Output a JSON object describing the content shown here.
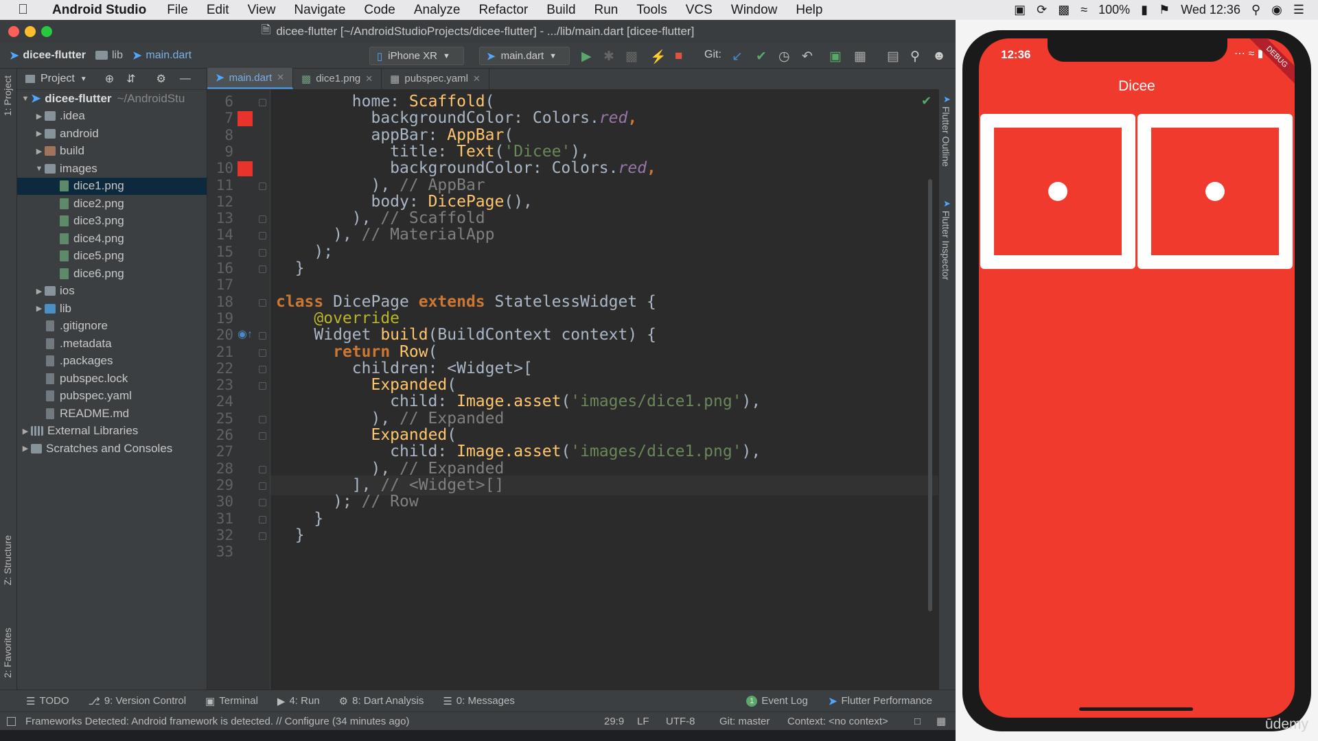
{
  "menubar": {
    "app": "Android Studio",
    "items": [
      "File",
      "Edit",
      "View",
      "Navigate",
      "Code",
      "Analyze",
      "Refactor",
      "Build",
      "Run",
      "Tools",
      "VCS",
      "Window",
      "Help"
    ],
    "battery": "100%",
    "clock": "Wed 12:36"
  },
  "window": {
    "title": "dicee-flutter [~/AndroidStudioProjects/dicee-flutter] - .../lib/main.dart [dicee-flutter]"
  },
  "breadcrumb": [
    "dicee-flutter",
    "lib",
    "main.dart"
  ],
  "toolbar": {
    "device": "iPhone XR",
    "config": "main.dart",
    "git_label": "Git:"
  },
  "project_panel": {
    "title": "Project",
    "root_name": "dicee-flutter",
    "root_path": "~/AndroidStu",
    "items": [
      {
        "name": ".idea",
        "depth": 1,
        "type": "folder",
        "expander": "closed"
      },
      {
        "name": "android",
        "depth": 1,
        "type": "folder",
        "expander": "closed"
      },
      {
        "name": "build",
        "depth": 1,
        "type": "folder-orange",
        "expander": "closed"
      },
      {
        "name": "images",
        "depth": 1,
        "type": "folder",
        "expander": "open"
      },
      {
        "name": "dice1.png",
        "depth": 2,
        "type": "img",
        "selected": true
      },
      {
        "name": "dice2.png",
        "depth": 2,
        "type": "img"
      },
      {
        "name": "dice3.png",
        "depth": 2,
        "type": "img"
      },
      {
        "name": "dice4.png",
        "depth": 2,
        "type": "img"
      },
      {
        "name": "dice5.png",
        "depth": 2,
        "type": "img"
      },
      {
        "name": "dice6.png",
        "depth": 2,
        "type": "img"
      },
      {
        "name": "ios",
        "depth": 1,
        "type": "folder",
        "expander": "closed"
      },
      {
        "name": "lib",
        "depth": 1,
        "type": "folder-blue",
        "expander": "closed"
      },
      {
        "name": ".gitignore",
        "depth": 1,
        "type": "file"
      },
      {
        "name": ".metadata",
        "depth": 1,
        "type": "file"
      },
      {
        "name": ".packages",
        "depth": 1,
        "type": "file"
      },
      {
        "name": "pubspec.lock",
        "depth": 1,
        "type": "file"
      },
      {
        "name": "pubspec.yaml",
        "depth": 1,
        "type": "file"
      },
      {
        "name": "README.md",
        "depth": 1,
        "type": "file"
      },
      {
        "name": "External Libraries",
        "depth": 0,
        "type": "lib",
        "expander": "closed"
      },
      {
        "name": "Scratches and Consoles",
        "depth": 0,
        "type": "scratch",
        "expander": "closed"
      }
    ]
  },
  "tabs": [
    {
      "label": "main.dart",
      "active": true
    },
    {
      "label": "dice1.png",
      "active": false
    },
    {
      "label": "pubspec.yaml",
      "active": false
    }
  ],
  "side_labels": {
    "project": "1: Project",
    "structure": "Z: Structure",
    "favorites": "2: Favorites",
    "flutter_outline": "Flutter Outline",
    "flutter_inspector": "Flutter Inspector"
  },
  "code": [
    {
      "n": "6",
      "t": [
        [
          "",
          "        home: "
        ],
        [
          "fn",
          "Scaffold"
        ],
        [
          "",
          "("
        ]
      ]
    },
    {
      "n": "7",
      "t": [
        [
          "",
          "          backgroundColor: Colors."
        ],
        [
          "it",
          "red"
        ],
        [
          "kw",
          ","
        ]
      ]
    },
    {
      "n": "8",
      "t": [
        [
          "",
          "          appBar: "
        ],
        [
          "fn",
          "AppBar"
        ],
        [
          "",
          "("
        ]
      ]
    },
    {
      "n": "9",
      "t": [
        [
          "",
          "            title: "
        ],
        [
          "fn",
          "Text"
        ],
        [
          "",
          "("
        ],
        [
          "str",
          "'Dicee'"
        ],
        [
          "",
          "),"
        ]
      ]
    },
    {
      "n": "10",
      "t": [
        [
          "",
          "            backgroundColor: Colors."
        ],
        [
          "it",
          "red"
        ],
        [
          "kw",
          ","
        ]
      ]
    },
    {
      "n": "11",
      "t": [
        [
          "",
          "          ), "
        ],
        [
          "cm",
          "// AppBar"
        ]
      ]
    },
    {
      "n": "12",
      "t": [
        [
          "",
          "          body: "
        ],
        [
          "fn",
          "DicePage"
        ],
        [
          "",
          "(),"
        ]
      ]
    },
    {
      "n": "13",
      "t": [
        [
          "",
          "        ), "
        ],
        [
          "cm",
          "// Scaffold"
        ]
      ]
    },
    {
      "n": "14",
      "t": [
        [
          "",
          "      ), "
        ],
        [
          "cm",
          "// MaterialApp"
        ]
      ]
    },
    {
      "n": "15",
      "t": [
        [
          "",
          "    );"
        ]
      ]
    },
    {
      "n": "16",
      "t": [
        [
          "",
          "  }"
        ]
      ]
    },
    {
      "n": "17",
      "t": [
        [
          "",
          ""
        ]
      ]
    },
    {
      "n": "18",
      "t": [
        [
          "kw",
          "class "
        ],
        [
          "",
          "DicePage "
        ],
        [
          "kw",
          "extends "
        ],
        [
          "",
          "StatelessWidget {"
        ]
      ]
    },
    {
      "n": "19",
      "t": [
        [
          "",
          "    "
        ],
        [
          "ann",
          "@override"
        ]
      ]
    },
    {
      "n": "20",
      "t": [
        [
          "",
          "    Widget "
        ],
        [
          "fn",
          "build"
        ],
        [
          "",
          "(BuildContext context) {"
        ]
      ]
    },
    {
      "n": "21",
      "t": [
        [
          "",
          "      "
        ],
        [
          "kw",
          "return "
        ],
        [
          "fn",
          "Row"
        ],
        [
          "",
          "("
        ]
      ]
    },
    {
      "n": "22",
      "t": [
        [
          "",
          "        children: <Widget>["
        ]
      ]
    },
    {
      "n": "23",
      "t": [
        [
          "",
          "          "
        ],
        [
          "fn",
          "Expanded"
        ],
        [
          "",
          "("
        ]
      ]
    },
    {
      "n": "24",
      "t": [
        [
          "",
          "            child: "
        ],
        [
          "fn",
          "Image.asset"
        ],
        [
          "",
          "("
        ],
        [
          "str",
          "'images/dice1.png'"
        ],
        [
          "",
          "),"
        ]
      ]
    },
    {
      "n": "25",
      "t": [
        [
          "",
          "          ), "
        ],
        [
          "cm",
          "// Expanded"
        ]
      ]
    },
    {
      "n": "26",
      "t": [
        [
          "",
          "          "
        ],
        [
          "fn",
          "Expanded"
        ],
        [
          "",
          "("
        ]
      ]
    },
    {
      "n": "27",
      "t": [
        [
          "",
          "            child: "
        ],
        [
          "fn",
          "Image.asset"
        ],
        [
          "",
          "("
        ],
        [
          "str",
          "'images/dice1.png'"
        ],
        [
          "",
          "),"
        ]
      ]
    },
    {
      "n": "28",
      "t": [
        [
          "",
          "          ), "
        ],
        [
          "cm",
          "// Expanded"
        ]
      ]
    },
    {
      "n": "29",
      "t": [
        [
          "",
          "        ], "
        ],
        [
          "cm",
          "// <Widget>[]"
        ]
      ]
    },
    {
      "n": "30",
      "t": [
        [
          "",
          "      ); "
        ],
        [
          "cm",
          "// Row"
        ]
      ]
    },
    {
      "n": "31",
      "t": [
        [
          "",
          "    }"
        ]
      ]
    },
    {
      "n": "32",
      "t": [
        [
          "",
          "  }"
        ]
      ]
    },
    {
      "n": "33",
      "t": [
        [
          "",
          ""
        ]
      ]
    }
  ],
  "bottom_tools": [
    {
      "label": "TODO"
    },
    {
      "label": "9: Version Control"
    },
    {
      "label": "Terminal"
    },
    {
      "label": "4: Run"
    },
    {
      "label": "8: Dart Analysis"
    },
    {
      "label": "0: Messages"
    }
  ],
  "bottom_right_tools": [
    {
      "label": "Event Log",
      "badge": "1"
    },
    {
      "label": "Flutter Performance"
    }
  ],
  "status": {
    "message": "Frameworks Detected: Android framework is detected. // Configure (34 minutes ago)",
    "position": "29:9",
    "line_sep": "LF",
    "encoding": "UTF-8",
    "git": "Git: master",
    "context": "Context: <no context>"
  },
  "phone": {
    "time": "12:36",
    "app_title": "Dicee",
    "debug_banner": "DEBUG"
  },
  "watermark": "ūdemy",
  "colors": {
    "app_red": "#f03a2e",
    "editor_bg": "#2b2b2b",
    "accent_blue": "#4a88c7"
  }
}
